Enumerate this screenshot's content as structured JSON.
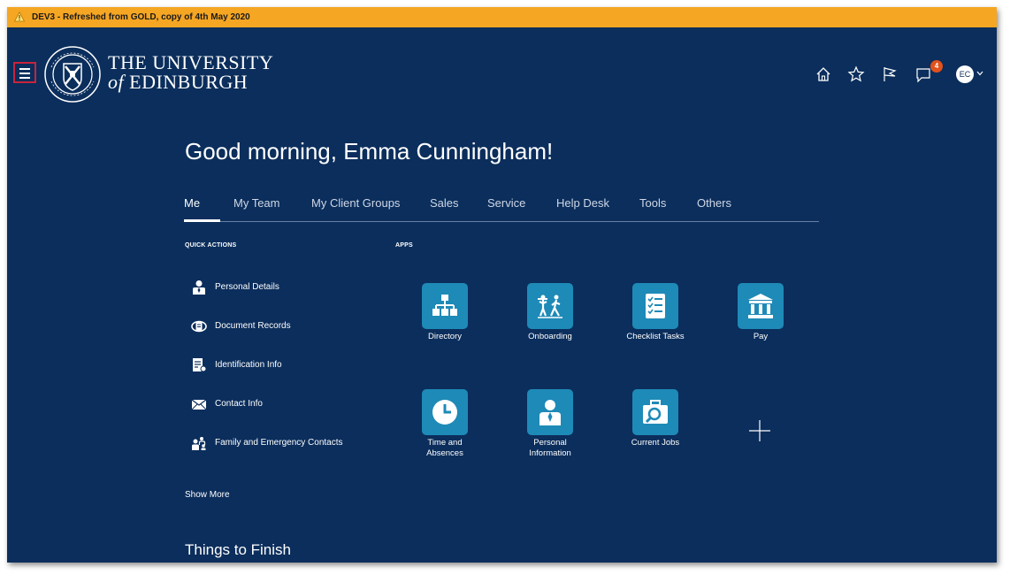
{
  "banner": {
    "text": "DEV3 - Refreshed from GOLD, copy of 4th May 2020",
    "color": "#f5a623"
  },
  "brand": {
    "line1": "THE UNIVERSITY",
    "line2_prefix": "of",
    "line2": "EDINBURGH"
  },
  "header": {
    "icons": [
      "home-icon",
      "favorites-star-icon",
      "flag-icon",
      "notifications-icon"
    ],
    "notification_count": "4",
    "avatar_initials": "EC"
  },
  "greeting": "Good morning, Emma Cunningham!",
  "tabs": [
    {
      "label": "Me",
      "active": true
    },
    {
      "label": "My Team"
    },
    {
      "label": "My Client Groups"
    },
    {
      "label": "Sales"
    },
    {
      "label": "Service"
    },
    {
      "label": "Help Desk"
    },
    {
      "label": "Tools"
    },
    {
      "label": "Others"
    }
  ],
  "quick_actions": {
    "heading": "QUICK ACTIONS",
    "items": [
      {
        "label": "Personal Details",
        "icon": "person-icon"
      },
      {
        "label": "Document Records",
        "icon": "document-records-icon"
      },
      {
        "label": "Identification Info",
        "icon": "identification-icon"
      },
      {
        "label": "Contact Info",
        "icon": "envelope-icon"
      },
      {
        "label": "Family and Emergency Contacts",
        "icon": "family-icon"
      }
    ],
    "show_more": "Show More"
  },
  "apps": {
    "heading": "APPS",
    "items": [
      {
        "label": "Directory",
        "icon": "org-chart-icon"
      },
      {
        "label": "Onboarding",
        "icon": "onboarding-icon"
      },
      {
        "label": "Checklist Tasks",
        "icon": "checklist-icon"
      },
      {
        "label": "Pay",
        "icon": "bank-icon"
      },
      {
        "label": "Time and Absences",
        "icon": "clock-icon"
      },
      {
        "label": "Personal Information",
        "icon": "person-icon"
      },
      {
        "label": "Current Jobs",
        "icon": "job-search-icon"
      }
    ],
    "add_icon": "plus-icon"
  },
  "things_to_finish": "Things to Finish",
  "colors": {
    "background": "#0b2e5c",
    "tile": "#1e8ab7",
    "badge": "#e2521c",
    "menu_highlight": "#c8243c"
  }
}
